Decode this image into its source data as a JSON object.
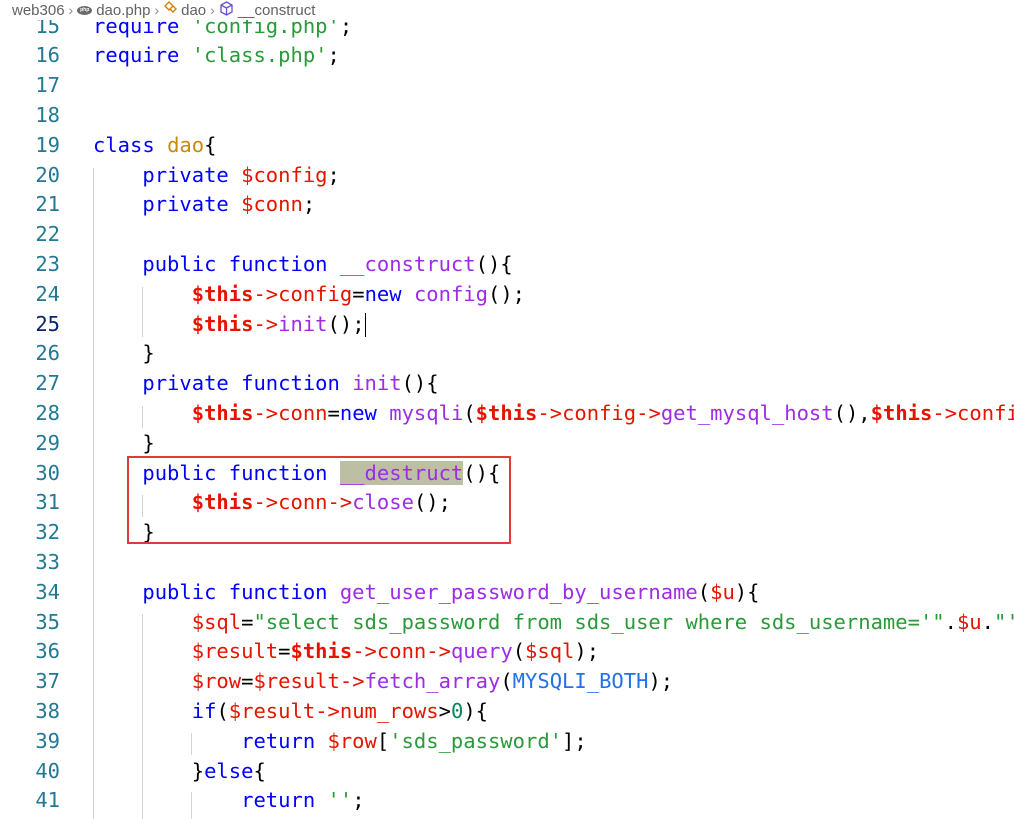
{
  "breadcrumb": {
    "folder": "web306",
    "file": "dao.php",
    "file_icon": "php-icon",
    "class_name": "dao",
    "class_icon": "class-icon",
    "method": "__construct",
    "method_icon": "method-cube-icon"
  },
  "editor": {
    "active_line": "25",
    "highlighted_region": "__destruct method (lines 30-32)",
    "lines": [
      {
        "no": "15",
        "tokens": [
          {
            "t": "require ",
            "c": "k"
          },
          {
            "t": "'config.php'",
            "c": "s"
          },
          {
            "t": ";",
            "c": ""
          }
        ]
      },
      {
        "no": "16",
        "tokens": [
          {
            "t": "require ",
            "c": "k"
          },
          {
            "t": "'class.php'",
            "c": "s"
          },
          {
            "t": ";",
            "c": ""
          }
        ]
      },
      {
        "no": "17",
        "tokens": []
      },
      {
        "no": "18",
        "tokens": []
      },
      {
        "no": "19",
        "tokens": [
          {
            "t": "class ",
            "c": "k"
          },
          {
            "t": "dao",
            "c": "c"
          },
          {
            "t": "{",
            "c": ""
          }
        ]
      },
      {
        "no": "20",
        "tokens": [
          {
            "t": "    private ",
            "c": "k"
          },
          {
            "t": "$config",
            "c": "v"
          },
          {
            "t": ";",
            "c": ""
          }
        ]
      },
      {
        "no": "21",
        "tokens": [
          {
            "t": "    private ",
            "c": "k"
          },
          {
            "t": "$conn",
            "c": "v"
          },
          {
            "t": ";",
            "c": ""
          }
        ]
      },
      {
        "no": "22",
        "tokens": []
      },
      {
        "no": "23",
        "tokens": [
          {
            "t": "    public function ",
            "c": "k"
          },
          {
            "t": "__construct",
            "c": "f"
          },
          {
            "t": "(){",
            "c": ""
          }
        ]
      },
      {
        "no": "24",
        "tokens": [
          {
            "t": "        ",
            "c": ""
          },
          {
            "t": "$this",
            "c": "vb"
          },
          {
            "t": "->",
            "c": "op"
          },
          {
            "t": "config",
            "c": "op"
          },
          {
            "t": "=",
            "c": ""
          },
          {
            "t": "new ",
            "c": "k"
          },
          {
            "t": "config",
            "c": "f"
          },
          {
            "t": "();",
            "c": ""
          }
        ]
      },
      {
        "no": "25",
        "tokens": [
          {
            "t": "        ",
            "c": ""
          },
          {
            "t": "$this",
            "c": "vb"
          },
          {
            "t": "->",
            "c": "op"
          },
          {
            "t": "init",
            "c": "f"
          },
          {
            "t": "();",
            "c": ""
          }
        ],
        "cursor": true
      },
      {
        "no": "26",
        "tokens": [
          {
            "t": "    }",
            "c": ""
          }
        ]
      },
      {
        "no": "27",
        "tokens": [
          {
            "t": "    private function ",
            "c": "k"
          },
          {
            "t": "init",
            "c": "f"
          },
          {
            "t": "(){",
            "c": ""
          }
        ]
      },
      {
        "no": "28",
        "tokens": [
          {
            "t": "        ",
            "c": ""
          },
          {
            "t": "$this",
            "c": "vb"
          },
          {
            "t": "->",
            "c": "op"
          },
          {
            "t": "conn",
            "c": "op"
          },
          {
            "t": "=",
            "c": ""
          },
          {
            "t": "new ",
            "c": "k"
          },
          {
            "t": "mysqli",
            "c": "f"
          },
          {
            "t": "(",
            "c": ""
          },
          {
            "t": "$this",
            "c": "vb"
          },
          {
            "t": "->",
            "c": "op"
          },
          {
            "t": "config",
            "c": "op"
          },
          {
            "t": "->",
            "c": "op"
          },
          {
            "t": "get_mysql_host",
            "c": "f"
          },
          {
            "t": "(),",
            "c": ""
          },
          {
            "t": "$this",
            "c": "vb"
          },
          {
            "t": "->",
            "c": "op"
          },
          {
            "t": "config",
            "c": "op"
          }
        ]
      },
      {
        "no": "29",
        "tokens": [
          {
            "t": "    }",
            "c": ""
          }
        ]
      },
      {
        "no": "30",
        "tokens": [
          {
            "t": "    public function ",
            "c": "k"
          },
          {
            "t": "__destruct",
            "c": "f hl"
          },
          {
            "t": "(){",
            "c": ""
          }
        ]
      },
      {
        "no": "31",
        "tokens": [
          {
            "t": "        ",
            "c": ""
          },
          {
            "t": "$this",
            "c": "vb"
          },
          {
            "t": "->",
            "c": "op"
          },
          {
            "t": "conn",
            "c": "op"
          },
          {
            "t": "->",
            "c": "op"
          },
          {
            "t": "close",
            "c": "f"
          },
          {
            "t": "();",
            "c": ""
          }
        ]
      },
      {
        "no": "32",
        "tokens": [
          {
            "t": "    }",
            "c": ""
          }
        ]
      },
      {
        "no": "33",
        "tokens": []
      },
      {
        "no": "34",
        "tokens": [
          {
            "t": "    public function ",
            "c": "k"
          },
          {
            "t": "get_user_password_by_username",
            "c": "f"
          },
          {
            "t": "(",
            "c": ""
          },
          {
            "t": "$u",
            "c": "v"
          },
          {
            "t": "){",
            "c": ""
          }
        ]
      },
      {
        "no": "35",
        "tokens": [
          {
            "t": "        ",
            "c": ""
          },
          {
            "t": "$sql",
            "c": "v"
          },
          {
            "t": "=",
            "c": ""
          },
          {
            "t": "\"select sds_password from sds_user where sds_username='\"",
            "c": "s"
          },
          {
            "t": ".",
            "c": ""
          },
          {
            "t": "$u",
            "c": "v"
          },
          {
            "t": ".",
            "c": ""
          },
          {
            "t": "\"'",
            "c": "s"
          }
        ]
      },
      {
        "no": "36",
        "tokens": [
          {
            "t": "        ",
            "c": ""
          },
          {
            "t": "$result",
            "c": "v"
          },
          {
            "t": "=",
            "c": ""
          },
          {
            "t": "$this",
            "c": "vb"
          },
          {
            "t": "->",
            "c": "op"
          },
          {
            "t": "conn",
            "c": "op"
          },
          {
            "t": "->",
            "c": "op"
          },
          {
            "t": "query",
            "c": "f"
          },
          {
            "t": "(",
            "c": ""
          },
          {
            "t": "$sql",
            "c": "v"
          },
          {
            "t": ");",
            "c": ""
          }
        ]
      },
      {
        "no": "37",
        "tokens": [
          {
            "t": "        ",
            "c": ""
          },
          {
            "t": "$row",
            "c": "v"
          },
          {
            "t": "=",
            "c": ""
          },
          {
            "t": "$result",
            "c": "v"
          },
          {
            "t": "->",
            "c": "op"
          },
          {
            "t": "fetch_array",
            "c": "f"
          },
          {
            "t": "(",
            "c": ""
          },
          {
            "t": "MYSQLI_BOTH",
            "c": "cn"
          },
          {
            "t": ");",
            "c": ""
          }
        ]
      },
      {
        "no": "38",
        "tokens": [
          {
            "t": "        ",
            "c": ""
          },
          {
            "t": "if",
            "c": "k"
          },
          {
            "t": "(",
            "c": ""
          },
          {
            "t": "$result",
            "c": "v"
          },
          {
            "t": "->",
            "c": "op"
          },
          {
            "t": "num_rows",
            "c": "op"
          },
          {
            "t": ">",
            "c": ""
          },
          {
            "t": "0",
            "c": "n"
          },
          {
            "t": "){",
            "c": ""
          }
        ]
      },
      {
        "no": "39",
        "tokens": [
          {
            "t": "            return ",
            "c": "k"
          },
          {
            "t": "$row",
            "c": "v"
          },
          {
            "t": "[",
            "c": ""
          },
          {
            "t": "'sds_password'",
            "c": "s"
          },
          {
            "t": "];",
            "c": ""
          }
        ]
      },
      {
        "no": "40",
        "tokens": [
          {
            "t": "        }",
            "c": ""
          },
          {
            "t": "else",
            "c": "k"
          },
          {
            "t": "{",
            "c": ""
          }
        ]
      },
      {
        "no": "41",
        "tokens": [
          {
            "t": "            return ",
            "c": "k"
          },
          {
            "t": "''",
            "c": "s"
          },
          {
            "t": ";",
            "c": ""
          }
        ]
      }
    ]
  }
}
